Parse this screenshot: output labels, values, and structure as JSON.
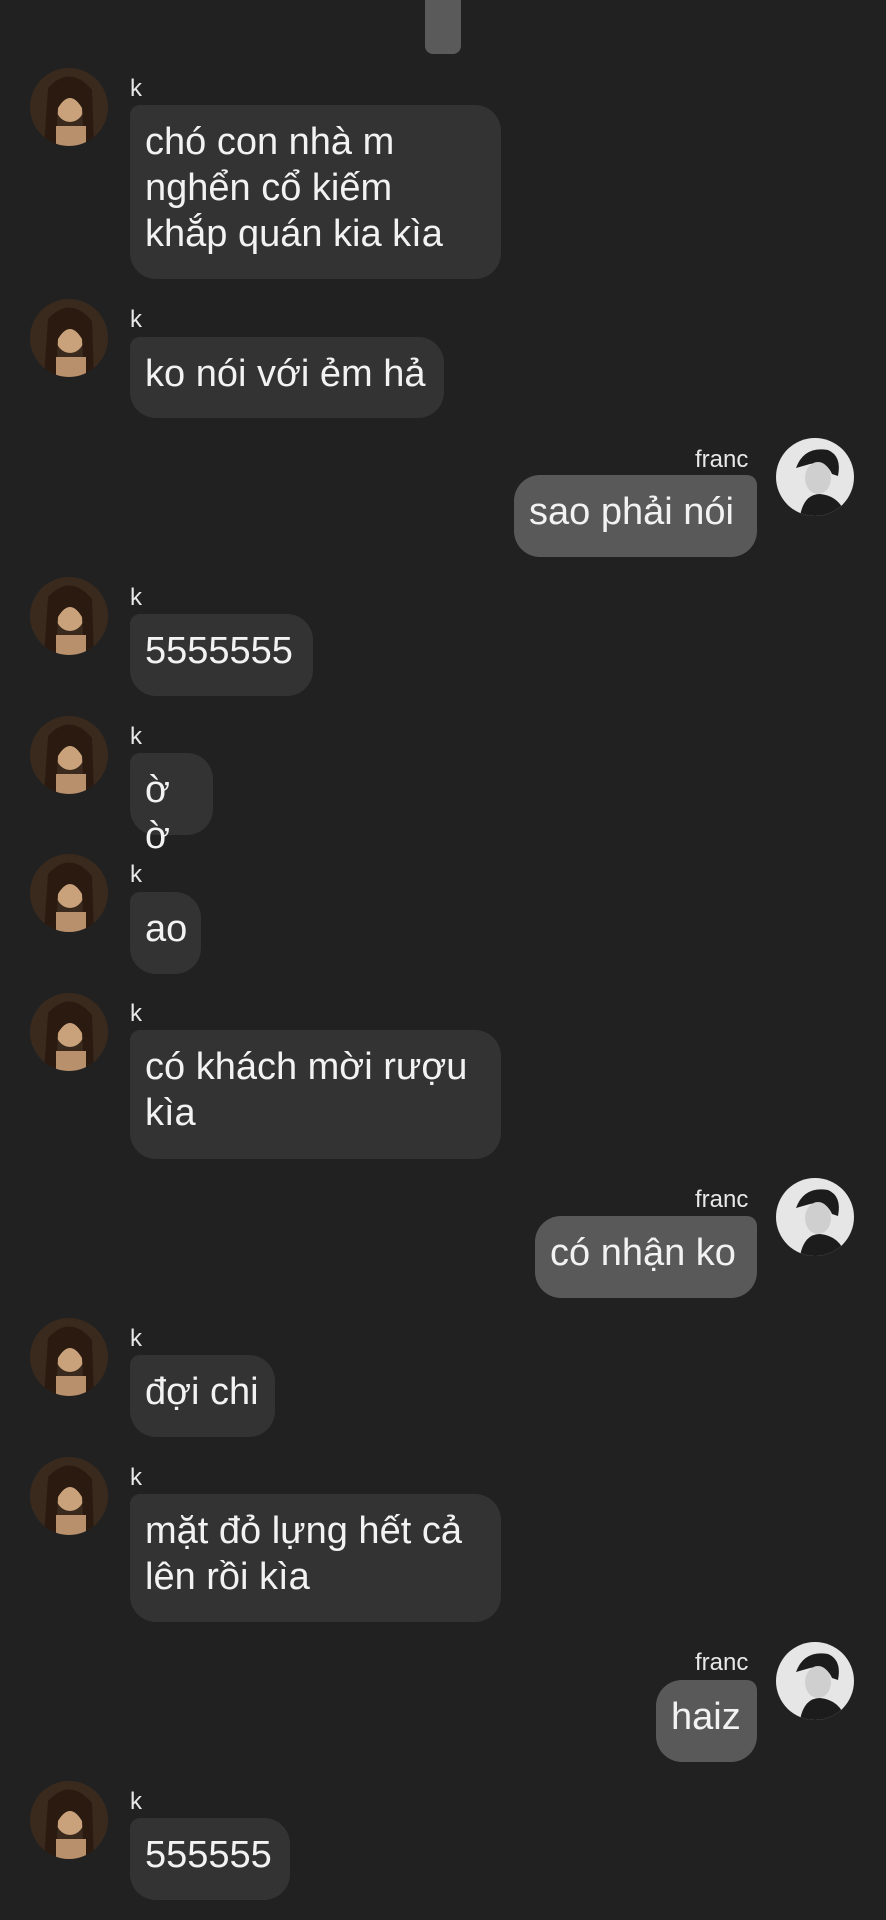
{
  "colors": {
    "background": "#212121",
    "incoming_bubble": "#333333",
    "outgoing_bubble": "#595959",
    "text": "#f2f2f2"
  },
  "messages": [
    {
      "sender": "k",
      "direction": "incoming",
      "text": "chó con nhà m\nnghển cổ kiếm\nkhắp quán kia kìa"
    },
    {
      "sender": "k",
      "direction": "incoming",
      "text": "ko nói với ẻm hả"
    },
    {
      "sender": "franc",
      "direction": "outgoing",
      "text": "sao phải nói"
    },
    {
      "sender": "k",
      "direction": "incoming",
      "text": "5555555"
    },
    {
      "sender": "k",
      "direction": "incoming",
      "text": "ờ ờ"
    },
    {
      "sender": "k",
      "direction": "incoming",
      "text": "ao"
    },
    {
      "sender": "k",
      "direction": "incoming",
      "text": "có khách mời rượu\nkìa"
    },
    {
      "sender": "franc",
      "direction": "outgoing",
      "text": "có nhận ko"
    },
    {
      "sender": "k",
      "direction": "incoming",
      "text": "đợi chi"
    },
    {
      "sender": "k",
      "direction": "incoming",
      "text": "mặt đỏ lựng hết cả\nlên rồi kìa"
    },
    {
      "sender": "franc",
      "direction": "outgoing",
      "text": "haiz"
    },
    {
      "sender": "k",
      "direction": "incoming",
      "text": "555555"
    }
  ]
}
